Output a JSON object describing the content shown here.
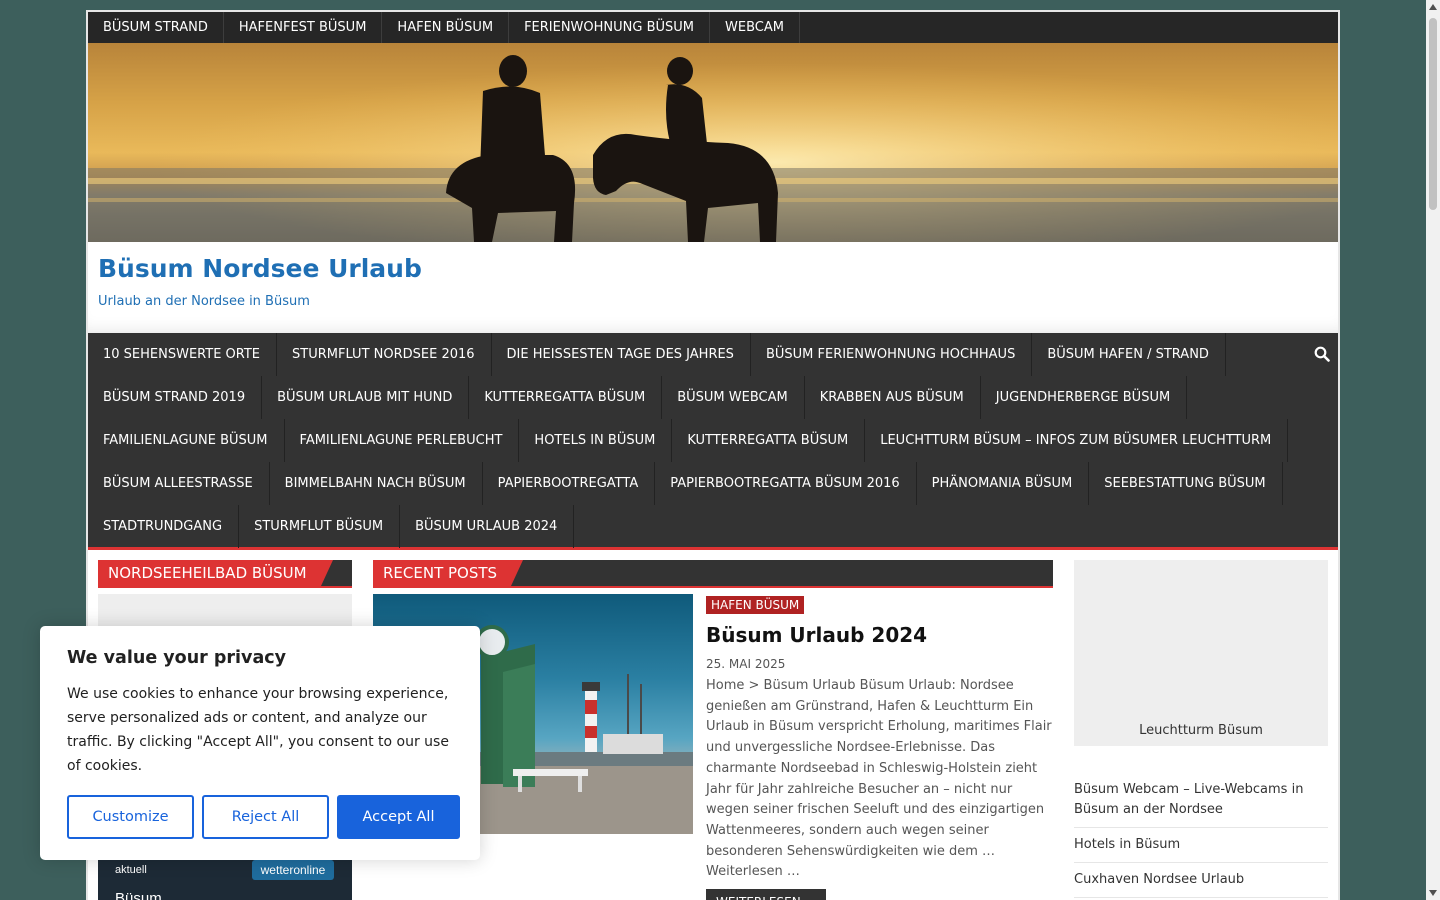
{
  "top_nav": [
    "BÜSUM STRAND",
    "HAFENFEST BÜSUM",
    "HAFEN BÜSUM",
    "FERIENWOHNUNG BÜSUM",
    "WEBCAM"
  ],
  "site": {
    "title": "Büsum Nordsee Urlaub",
    "description": "Urlaub an der Nordsee in Büsum"
  },
  "main_nav": [
    [
      "10 SEHENSWERTE ORTE",
      "STURMFLUT NORDSEE 2016",
      "DIE HEISSESTEN TAGE DES JAHRES",
      "BÜSUM FERIENWOHNUNG HOCHHAUS",
      "BÜSUM HAFEN / STRAND"
    ],
    [
      "BÜSUM STRAND 2019",
      "BÜSUM URLAUB MIT HUND",
      "KUTTERREGATTA BÜSUM",
      "BÜSUM WEBCAM",
      "KRABBEN AUS BÜSUM",
      "JUGENDHERBERGE BÜSUM"
    ],
    [
      "FAMILIENLAGUNE BÜSUM",
      "FAMILIENLAGUNE PERLEBUCHT",
      "HOTELS IN BÜSUM",
      "KUTTERREGATTA BÜSUM",
      "LEUCHTTURM BÜSUM – INFOS ZUM BÜSUMER LEUCHTTURM"
    ],
    [
      "BÜSUM ALLEESTRASSE",
      "BIMMELBAHN NACH BÜSUM",
      "PAPIERBOOTREGATTA",
      "PAPIERBOOTREGATTA BÜSUM 2016",
      "PHÄNOMANIA BÜSUM",
      "SEEBESTATTUNG BÜSUM"
    ],
    [
      "STADTRUNDGANG",
      "STURMFLUT BÜSUM",
      "BÜSUM URLAUB 2024"
    ]
  ],
  "left_widget": {
    "title": "NORDSEEHEILBAD BÜSUM",
    "weather_label": "aktuell",
    "weather_logo": "wetteronline",
    "weather_city": "Büsum"
  },
  "recent_posts": {
    "title": "RECENT POSTS",
    "post": {
      "category": "HAFEN BÜSUM",
      "title": "Büsum Urlaub 2024",
      "date": "25. MAI 2025",
      "excerpt": "Home > Büsum Urlaub Büsum Urlaub: Nordsee genießen am Grünstrand, Hafen & Leuchtturm Ein Urlaub in Büsum verspricht Erholung, maritimes Flair und unvergessliche Nordsee-Erlebnisse. Das charmante Nordseebad in Schleswig-Holstein zieht Jahr für Jahr zahlreiche Besucher an – nicht nur wegen seiner frischen Seeluft und des einzigartigen Wattenmeeres, sondern auch wegen seiner besonderen Sehenswürdigkeiten wie dem … Weiterlesen …",
      "read_more": "WEITERLESEN ..."
    }
  },
  "right_widget": {
    "image_caption": "Leuchtturm Büsum",
    "links": [
      "Büsum Webcam – Live-Webcams in Büsum an der Nordsee",
      "Hotels in Büsum",
      "Cuxhaven Nordsee Urlaub"
    ]
  },
  "cookie_banner": {
    "title": "We value your privacy",
    "text": "We use cookies to enhance your browsing experience, serve personalized ads or content, and analyze our traffic. By clicking \"Accept All\", you consent to our use of cookies.",
    "customize": "Customize",
    "reject": "Reject All",
    "accept": "Accept All"
  },
  "colors": {
    "accent": "#dd3333",
    "title_blue": "#1f6fb4",
    "nav_bg": "#333333",
    "cookie_button": "#1863dc"
  }
}
